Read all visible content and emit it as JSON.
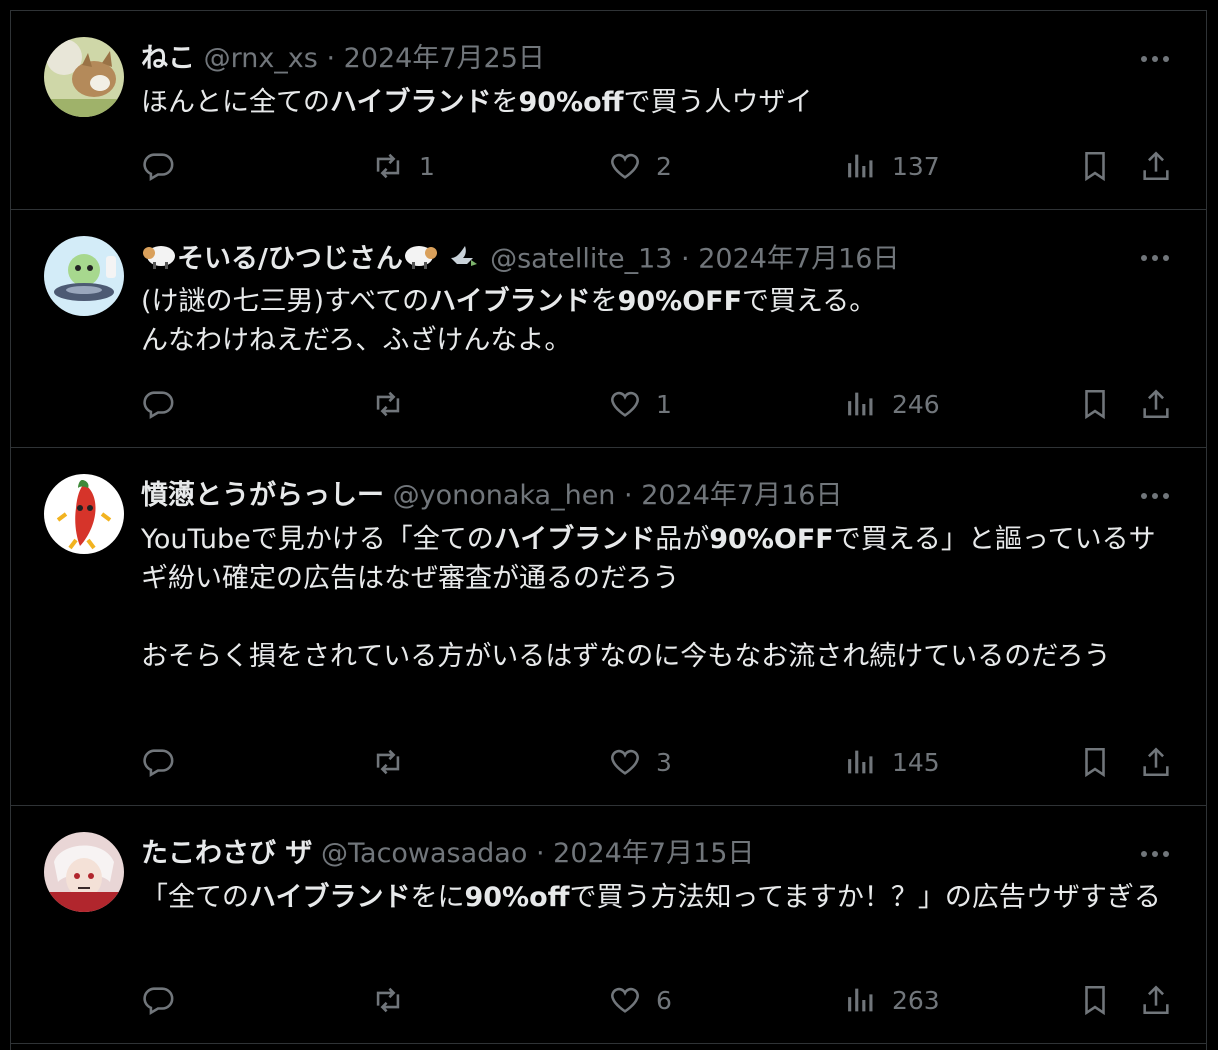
{
  "tweets": [
    {
      "name": "ねこ",
      "handle": "@rnx_xs",
      "date": "2024年7月25日",
      "text_parts": [
        "ほんとに全ての",
        "ハイブランド",
        "を",
        "90%off",
        "で買う人ウザイ"
      ],
      "text_bold": [
        false,
        true,
        false,
        true,
        false
      ],
      "retweets": "1",
      "likes": "2",
      "views": "137",
      "avatar_colors": [
        "#d9c9a0",
        "#a98b5c",
        "#f1eee6"
      ]
    },
    {
      "name": "そいる/ひつじさん",
      "handle": "@satellite_13",
      "date": "2024年7月16日",
      "text_parts": [
        "(け謎の七三男)すべての",
        "ハイブランド",
        "を",
        "90%OFF",
        "で買える。\nんなわけねえだろ、ふざけんなよ。"
      ],
      "text_bold": [
        false,
        true,
        false,
        true,
        false
      ],
      "retweets": "",
      "likes": "1",
      "views": "246",
      "avatar_colors": [
        "#cfe7f5",
        "#5a6f86",
        "#9fd08b"
      ]
    },
    {
      "name": "憤懣とうがらっしー",
      "handle": "@yononaka_hen",
      "date": "2024年7月16日",
      "text_parts": [
        "YouTubeで見かける「全ての",
        "ハイブランド",
        "品が",
        "90%OFF",
        "で買える」と謳っているサギ紛い確定の広告はなぜ審査が通るのだろう\n\nおそらく損をされている方がいるはずなのに今もなお流され続けているのだろう"
      ],
      "text_bold": [
        false,
        true,
        false,
        true,
        false
      ],
      "retweets": "",
      "likes": "3",
      "views": "145",
      "avatar_colors": [
        "#ffffff",
        "#d6342a",
        "#f2b320"
      ]
    },
    {
      "name": "たこわさび ザ",
      "handle": "@Tacowasadao",
      "date": "2024年7月15日",
      "text_parts": [
        "「全ての",
        "ハイブランド",
        "をに",
        "90%off",
        "で買う方法知ってますか！？」の広告ウザすぎる"
      ],
      "text_bold": [
        false,
        true,
        false,
        true,
        false
      ],
      "retweets": "",
      "likes": "6",
      "views": "263",
      "avatar_colors": [
        "#e9d6d6",
        "#b1262d",
        "#3a2a2a"
      ]
    }
  ],
  "colors": {
    "background": "#000000",
    "border": "#2f3336",
    "text": "#e7e9ea",
    "muted": "#71767b"
  },
  "icons": [
    "reply-icon",
    "retweet-icon",
    "like-icon",
    "views-icon",
    "bookmark-icon",
    "share-icon",
    "more-icon"
  ]
}
